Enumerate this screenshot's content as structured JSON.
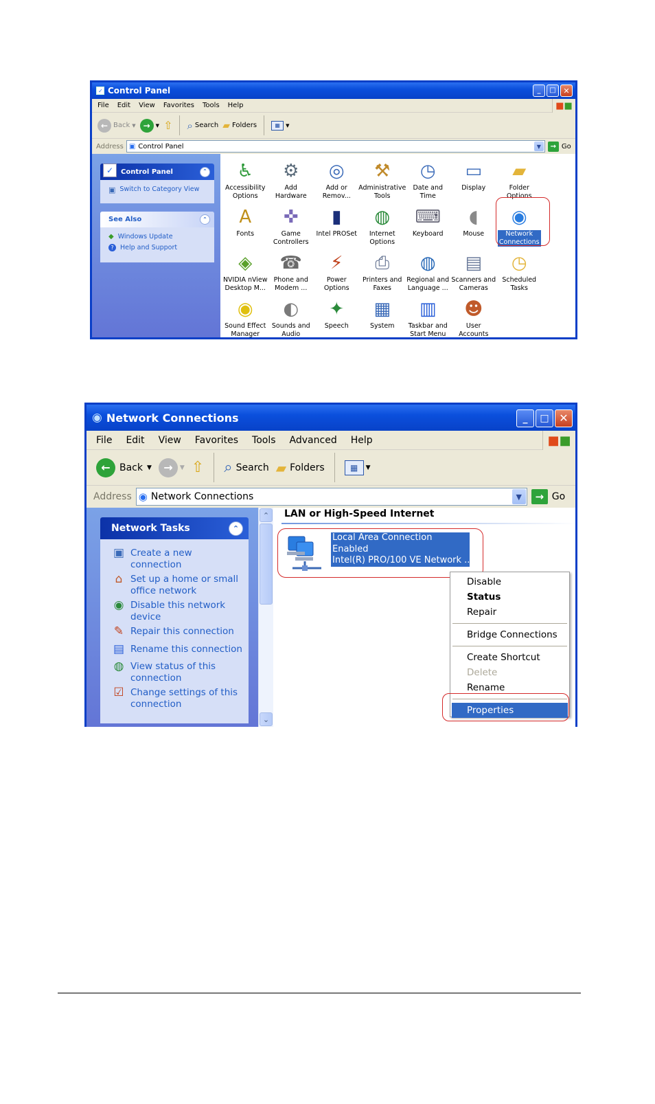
{
  "control_panel": {
    "title": "Control Panel",
    "menu": [
      "File",
      "Edit",
      "View",
      "Favorites",
      "Tools",
      "Help"
    ],
    "toolbar": {
      "back": "Back",
      "search": "Search",
      "folders": "Folders"
    },
    "address_label": "Address",
    "address_value": "Control Panel",
    "go": "Go",
    "sidebar": {
      "panel_title": "Control Panel",
      "switch_view": "Switch to Category View",
      "see_also_title": "See Also",
      "see_also_items": [
        "Windows Update",
        "Help and Support"
      ]
    },
    "items": [
      {
        "line1": "Accessibility",
        "line2": "Options",
        "icon": "accessibility-icon"
      },
      {
        "line1": "Add Hardware",
        "line2": "",
        "icon": "add-hardware-icon"
      },
      {
        "line1": "Add or",
        "line2": "Remov...",
        "icon": "add-remove-programs-icon"
      },
      {
        "line1": "Administrative",
        "line2": "Tools",
        "icon": "administrative-tools-icon"
      },
      {
        "line1": "Date and Time",
        "line2": "",
        "icon": "date-time-icon"
      },
      {
        "line1": "Display",
        "line2": "",
        "icon": "display-icon"
      },
      {
        "line1": "Folder Options",
        "line2": "",
        "icon": "folder-options-icon"
      },
      {
        "line1": "Fonts",
        "line2": "",
        "icon": "fonts-icon"
      },
      {
        "line1": "Game",
        "line2": "Controllers",
        "icon": "game-controllers-icon"
      },
      {
        "line1": "Intel PROSet",
        "line2": "",
        "icon": "intel-proset-icon"
      },
      {
        "line1": "Internet",
        "line2": "Options",
        "icon": "internet-options-icon"
      },
      {
        "line1": "Keyboard",
        "line2": "",
        "icon": "keyboard-icon"
      },
      {
        "line1": "Mouse",
        "line2": "",
        "icon": "mouse-icon"
      },
      {
        "line1": "Network",
        "line2": "Connections",
        "icon": "network-connections-icon",
        "selected": true
      },
      {
        "line1": "NVIDIA nView",
        "line2": "Desktop M...",
        "icon": "nvidia-icon"
      },
      {
        "line1": "Phone and",
        "line2": "Modem ...",
        "icon": "phone-modem-icon"
      },
      {
        "line1": "Power Options",
        "line2": "",
        "icon": "power-options-icon"
      },
      {
        "line1": "Printers and",
        "line2": "Faxes",
        "icon": "printers-faxes-icon"
      },
      {
        "line1": "Regional and",
        "line2": "Language ...",
        "icon": "regional-language-icon"
      },
      {
        "line1": "Scanners and",
        "line2": "Cameras",
        "icon": "scanners-cameras-icon"
      },
      {
        "line1": "Scheduled",
        "line2": "Tasks",
        "icon": "scheduled-tasks-icon"
      },
      {
        "line1": "Sound Effect",
        "line2": "Manager",
        "icon": "sound-effect-icon"
      },
      {
        "line1": "Sounds and",
        "line2": "Audio Devices",
        "icon": "sounds-audio-icon"
      },
      {
        "line1": "Speech",
        "line2": "",
        "icon": "speech-icon"
      },
      {
        "line1": "System",
        "line2": "",
        "icon": "system-icon"
      },
      {
        "line1": "Taskbar and",
        "line2": "Start Menu",
        "icon": "taskbar-start-icon"
      },
      {
        "line1": "User Accounts",
        "line2": "",
        "icon": "user-accounts-icon"
      }
    ]
  },
  "network_connections": {
    "title": "Network Connections",
    "menu": [
      "File",
      "Edit",
      "View",
      "Favorites",
      "Tools",
      "Advanced",
      "Help"
    ],
    "toolbar": {
      "back": "Back",
      "search": "Search",
      "folders": "Folders"
    },
    "address_label": "Address",
    "address_value": "Network Connections",
    "go": "Go",
    "tasks_title": "Network Tasks",
    "tasks": [
      {
        "line1": "Create a new",
        "line2": "connection",
        "icon": "new-connection-icon"
      },
      {
        "line1": "Set up a home or small",
        "line2": "office network",
        "icon": "home-network-icon"
      },
      {
        "line1": "Disable this network",
        "line2": "device",
        "icon": "disable-network-icon"
      },
      {
        "line1": "Repair this connection",
        "line2": "",
        "icon": "repair-icon"
      },
      {
        "line1": "Rename this connection",
        "line2": "",
        "icon": "rename-icon"
      },
      {
        "line1": "View status of this",
        "line2": "connection",
        "icon": "status-icon"
      },
      {
        "line1": "Change settings of this",
        "line2": "connection",
        "icon": "settings-icon"
      }
    ],
    "group_header": "LAN or High-Speed Internet",
    "connection": {
      "name": "Local Area Connection",
      "status": "Enabled",
      "device": "Intel(R) PRO/100 VE Network ..."
    },
    "context_menu": {
      "disable": "Disable",
      "status": "Status",
      "repair": "Repair",
      "bridge": "Bridge Connections",
      "shortcut": "Create Shortcut",
      "delete": "Delete",
      "rename": "Rename",
      "properties": "Properties"
    }
  },
  "colors": {
    "xp_blue": "#0a3fc7",
    "selection": "#316ac5",
    "highlight_ring": "#d42a2a",
    "task_link": "#215dc6"
  }
}
